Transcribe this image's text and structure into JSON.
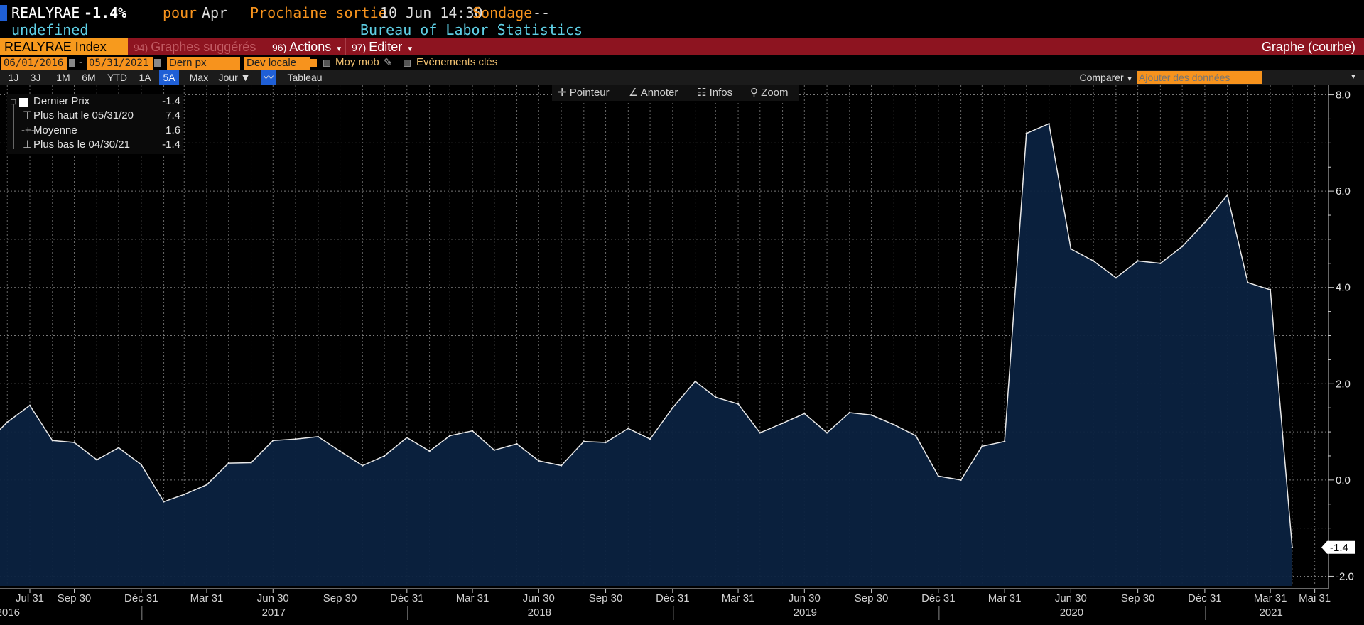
{
  "header": {
    "ticker": "REALYRAE",
    "change": "-1.4%",
    "pour": "pour",
    "period": "Apr",
    "next_release_label": "Prochaine sortie",
    "next_release": "10 Jun 14:30",
    "survey_label": "Sondage",
    "survey_value": "--",
    "undefined_text": "undefined",
    "source": "Bureau of Labor Statistics"
  },
  "toolbar": {
    "index_tab": "REALYRAE Index",
    "suggested_num": "94)",
    "suggested": "Graphes suggérés",
    "actions_num": "96)",
    "actions": "Actions",
    "edit_num": "97)",
    "edit": "Editer",
    "graph_type": "Graphe (courbe)"
  },
  "daterow": {
    "start": "06/01/2016",
    "sep": "-",
    "end": "05/31/2021",
    "price_field": "Dern px",
    "currency": "Dev locale",
    "moving_avg": "Moy mob",
    "events": "Evènements clés"
  },
  "ranges": {
    "items": [
      "1J",
      "3J",
      "1M",
      "6M",
      "YTD",
      "1A",
      "5A",
      "Max"
    ],
    "active": "5A",
    "period": "Jour",
    "table": "Tableau",
    "compare": "Comparer",
    "add_data_placeholder": "Ajouter des données"
  },
  "chart_tools": {
    "pointer": "Pointeur",
    "annotate": "Annoter",
    "infos": "Infos",
    "zoom": "Zoom"
  },
  "legend": {
    "rows": [
      {
        "label": "Dernier Prix",
        "value": "-1.4"
      },
      {
        "label": "Plus haut le 05/31/20",
        "value": "7.4"
      },
      {
        "label": "Moyenne",
        "value": "1.6"
      },
      {
        "label": "Plus bas le 04/30/21",
        "value": "-1.4"
      }
    ]
  },
  "colors": {
    "background": "#000000",
    "area_fill": "#0b2240",
    "line": "#e8e8e8",
    "red_bar": "#8d1420",
    "orange": "#f7931d",
    "blue_active": "#1f5fd6",
    "cyan_text": "#5fd0e6",
    "orange_text": "#f7931d"
  },
  "chart_data": {
    "type": "area",
    "x": [
      "2016-06-30",
      "2016-07-31",
      "2016-08-31",
      "2016-09-30",
      "2016-10-31",
      "2016-11-30",
      "2016-12-31",
      "2017-01-31",
      "2017-02-28",
      "2017-03-31",
      "2017-04-30",
      "2017-05-31",
      "2017-06-30",
      "2017-07-31",
      "2017-08-31",
      "2017-09-30",
      "2017-10-31",
      "2017-11-30",
      "2017-12-31",
      "2018-01-31",
      "2018-02-28",
      "2018-03-31",
      "2018-04-30",
      "2018-05-31",
      "2018-06-30",
      "2018-07-31",
      "2018-08-31",
      "2018-09-30",
      "2018-10-31",
      "2018-11-30",
      "2018-12-31",
      "2019-01-31",
      "2019-02-28",
      "2019-03-31",
      "2019-04-30",
      "2019-05-31",
      "2019-06-30",
      "2019-07-31",
      "2019-08-31",
      "2019-09-30",
      "2019-10-31",
      "2019-11-30",
      "2019-12-31",
      "2020-01-31",
      "2020-02-29",
      "2020-03-31",
      "2020-04-30",
      "2020-05-31",
      "2020-06-30",
      "2020-07-31",
      "2020-08-31",
      "2020-09-30",
      "2020-10-31",
      "2020-11-30",
      "2020-12-31",
      "2021-01-31",
      "2021-02-28",
      "2021-03-31",
      "2021-04-30"
    ],
    "series": [
      {
        "values": [
          1.2,
          1.55,
          0.82,
          0.78,
          0.42,
          0.67,
          0.32,
          -0.45,
          -0.3,
          -0.1,
          0.35,
          0.36,
          0.82,
          0.85,
          0.9,
          0.6,
          0.3,
          0.5,
          0.88,
          0.6,
          0.92,
          1.02,
          0.62,
          0.75,
          0.4,
          0.3,
          0.8,
          0.78,
          1.07,
          0.85,
          1.5,
          2.05,
          1.72,
          1.58,
          0.98,
          1.18,
          1.38,
          0.98,
          1.4,
          1.35,
          1.15,
          0.92,
          0.08,
          0.0,
          0.7,
          0.8,
          7.2,
          7.4,
          4.8,
          4.55,
          4.2,
          4.55,
          4.5,
          4.85,
          5.35,
          5.92,
          4.1,
          3.95,
          -1.4
        ]
      }
    ],
    "yticks": [
      8.0,
      6.0,
      4.0,
      2.0,
      0.0,
      -2.0
    ],
    "ytick_labels": [
      "8.0",
      "6.0",
      "4.0",
      "2.0",
      "0.0",
      "-2.0"
    ],
    "ylim": [
      -2.2,
      8.2
    ],
    "last_value_label": "-1.4",
    "xticks": [
      {
        "date": "2016-07-31",
        "label": "Jul 31"
      },
      {
        "date": "2016-09-30",
        "label": "Sep 30"
      },
      {
        "date": "2016-12-31",
        "label": "Déc 31"
      },
      {
        "date": "2017-03-31",
        "label": "Mar 31"
      },
      {
        "date": "2017-06-30",
        "label": "Jun 30"
      },
      {
        "date": "2017-09-30",
        "label": "Sep 30"
      },
      {
        "date": "2017-12-31",
        "label": "Déc 31"
      },
      {
        "date": "2018-03-31",
        "label": "Mar 31"
      },
      {
        "date": "2018-06-30",
        "label": "Jun 30"
      },
      {
        "date": "2018-09-30",
        "label": "Sep 30"
      },
      {
        "date": "2018-12-31",
        "label": "Déc 31"
      },
      {
        "date": "2019-03-31",
        "label": "Mar 31"
      },
      {
        "date": "2019-06-30",
        "label": "Jun 30"
      },
      {
        "date": "2019-09-30",
        "label": "Sep 30"
      },
      {
        "date": "2019-12-31",
        "label": "Déc 31"
      },
      {
        "date": "2020-03-31",
        "label": "Mar 31"
      },
      {
        "date": "2020-06-30",
        "label": "Jun 30"
      },
      {
        "date": "2020-09-30",
        "label": "Sep 30"
      },
      {
        "date": "2020-12-31",
        "label": "Déc 31"
      },
      {
        "date": "2021-03-31",
        "label": "Mar 31"
      },
      {
        "date": "2021-05-31",
        "label": "Mai 31"
      }
    ],
    "year_labels": [
      {
        "date": "2016-07-01",
        "label": "2016"
      },
      {
        "date": "2017-07-01",
        "label": "2017"
      },
      {
        "date": "2018-07-01",
        "label": "2018"
      },
      {
        "date": "2019-07-01",
        "label": "2019"
      },
      {
        "date": "2020-07-01",
        "label": "2020"
      },
      {
        "date": "2021-04-01",
        "label": "2021"
      }
    ],
    "year_boundaries": [
      "2017-01-01",
      "2018-01-01",
      "2019-01-01",
      "2020-01-01",
      "2021-01-01"
    ],
    "x_range": [
      "2016-06-20",
      "2021-06-15"
    ],
    "grid": true
  }
}
